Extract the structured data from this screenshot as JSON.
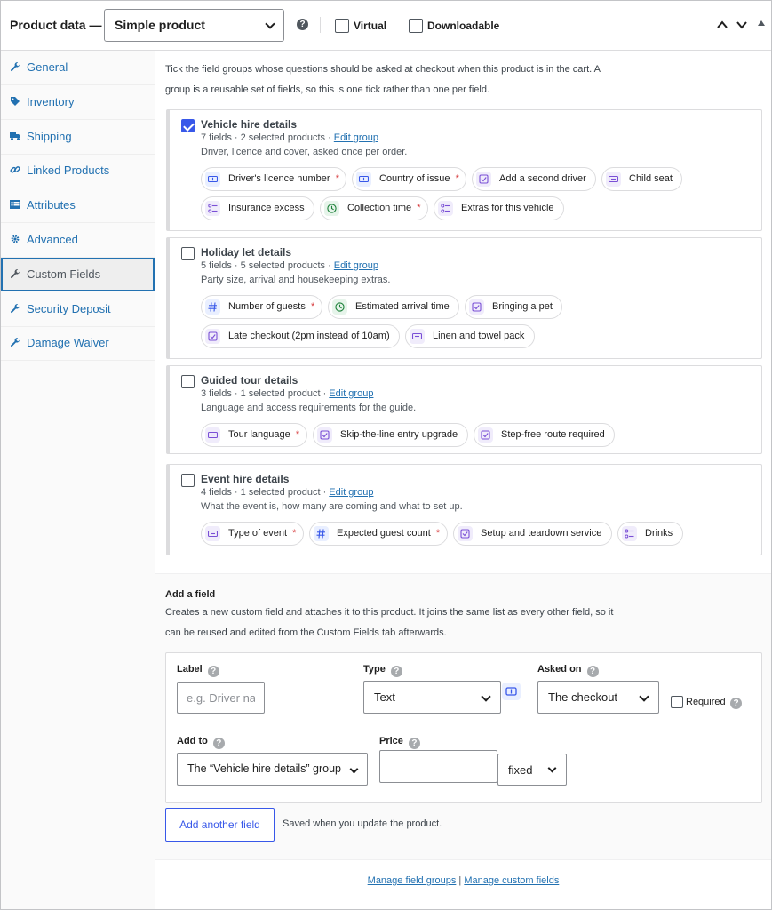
{
  "header": {
    "title": "Product data —",
    "product_type": "Simple product",
    "virtual_label": "Virtual",
    "downloadable_label": "Downloadable",
    "help": "?"
  },
  "tabs": [
    {
      "label": "General",
      "icon": "wrench-icon"
    },
    {
      "label": "Inventory",
      "icon": "tag-icon"
    },
    {
      "label": "Shipping",
      "icon": "truck-icon"
    },
    {
      "label": "Linked Products",
      "icon": "link-icon"
    },
    {
      "label": "Attributes",
      "icon": "list-icon"
    },
    {
      "label": "Advanced",
      "icon": "gear-icon"
    },
    {
      "label": "Custom Fields",
      "icon": "wrench-icon",
      "active": true
    },
    {
      "label": "Security Deposit",
      "icon": "wrench-icon"
    },
    {
      "label": "Damage Waiver",
      "icon": "wrench-icon"
    }
  ],
  "intro": {
    "line1": "Tick the field groups whose questions should be asked at checkout when this product is in the cart. A",
    "line2": "group is a reusable set of fields, so this is one tick rather than one per field."
  },
  "groups": [
    {
      "title": "Vehicle hire details",
      "meta": "7 fields · 2 selected products · ",
      "edit": "Edit group",
      "desc": "Driver, licence and cover, asked once per order.",
      "checked": true,
      "chips": [
        {
          "label": "Driver's licence number",
          "required": true,
          "icon": "text-field-icon"
        },
        {
          "label": "Country of issue",
          "required": true,
          "icon": "text-field-icon"
        },
        {
          "label": "Add a second driver",
          "required": false,
          "icon": "checkbox-field-icon"
        },
        {
          "label": "Child seat",
          "required": false,
          "icon": "select-field-icon"
        },
        {
          "label": "Insurance excess",
          "required": false,
          "icon": "radio-list-icon"
        },
        {
          "label": "Collection time",
          "required": true,
          "icon": "clock-icon"
        },
        {
          "label": "Extras for this vehicle",
          "required": false,
          "icon": "radio-list-icon"
        }
      ]
    },
    {
      "title": "Holiday let details",
      "meta": "5 fields · 5 selected products · ",
      "edit": "Edit group",
      "desc": "Party size, arrival and housekeeping extras.",
      "checked": false,
      "chips": [
        {
          "label": "Number of guests",
          "required": true,
          "icon": "number-icon"
        },
        {
          "label": "Estimated arrival time",
          "required": false,
          "icon": "clock-icon"
        },
        {
          "label": "Bringing a pet",
          "required": false,
          "icon": "checkbox-field-icon"
        },
        {
          "label": "Late checkout (2pm instead of 10am)",
          "required": false,
          "icon": "checkbox-field-icon"
        },
        {
          "label": "Linen and towel pack",
          "required": false,
          "icon": "select-field-icon"
        }
      ]
    },
    {
      "title": "Guided tour details",
      "meta": "3 fields · 1 selected product · ",
      "edit": "Edit group",
      "desc": "Language and access requirements for the guide.",
      "checked": false,
      "chips": [
        {
          "label": "Tour language",
          "required": true,
          "icon": "select-field-icon"
        },
        {
          "label": "Skip-the-line entry upgrade",
          "required": false,
          "icon": "checkbox-field-icon"
        },
        {
          "label": "Step-free route required",
          "required": false,
          "icon": "checkbox-field-icon"
        }
      ]
    },
    {
      "title": "Event hire details",
      "meta": "4 fields · 1 selected product · ",
      "edit": "Edit group",
      "desc": "What the event is, how many are coming and what to set up.",
      "checked": false,
      "chips": [
        {
          "label": "Type of event",
          "required": true,
          "icon": "select-field-icon"
        },
        {
          "label": "Expected guest count",
          "required": true,
          "icon": "number-icon"
        },
        {
          "label": "Setup and teardown service",
          "required": false,
          "icon": "checkbox-field-icon"
        },
        {
          "label": "Drinks",
          "required": false,
          "icon": "radio-list-icon"
        }
      ]
    }
  ],
  "add_field": {
    "title": "Add a field",
    "desc1": "Creates a new custom field and attaches it to this product. It joins the same list as every other field, so it",
    "desc2": "can be reused and edited from the Custom Fields tab afterwards.",
    "label_label": "Label",
    "label_placeholder": "e.g. Driver na",
    "type_label": "Type",
    "type_value": "Text",
    "asked_on_label": "Asked on",
    "asked_on_value": "The checkout",
    "required_label": "Required",
    "add_to_label": "Add to",
    "add_to_value": "The “Vehicle hire details” group",
    "price_label": "Price",
    "price_value": "",
    "price_type": "fixed",
    "add_another": "Add another field",
    "saved_note": "Saved when you update the product."
  },
  "footer": {
    "manage_groups": "Manage field groups",
    "sep": " | ",
    "manage_fields": "Manage custom fields"
  },
  "colors": {
    "accent": "#3858e9",
    "link": "#2271b1",
    "required": "#d63638"
  }
}
